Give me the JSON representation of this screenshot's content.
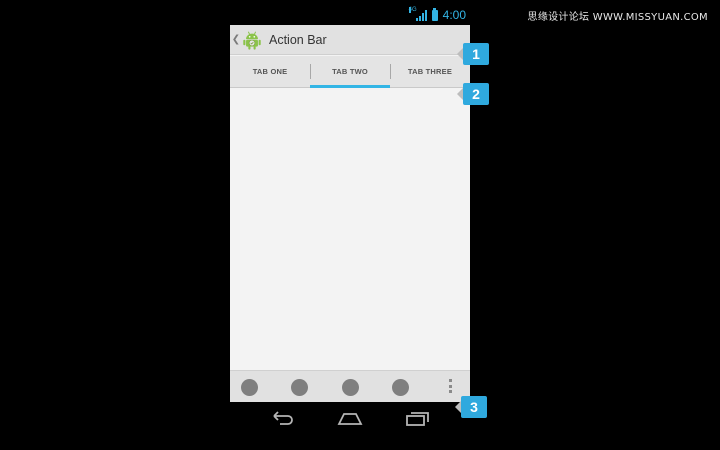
{
  "watermark": "思缘设计论坛 WWW.MISSYUAN.COM",
  "status_bar": {
    "network": "4G",
    "time": "4:00"
  },
  "action_bar": {
    "title": "Action Bar",
    "app_icon": "android-robot-icon"
  },
  "tabs": [
    {
      "label": "TAB ONE",
      "selected": false
    },
    {
      "label": "TAB TWO",
      "selected": true
    },
    {
      "label": "TAB THREE",
      "selected": false
    }
  ],
  "split_action_bar": {
    "action_count": 4,
    "overflow": "overflow-menu-icon"
  },
  "navigation": [
    "back-icon",
    "home-icon",
    "recents-icon"
  ],
  "callouts": [
    "1",
    "2",
    "3"
  ],
  "colors": {
    "accent": "#33b5e5",
    "callout": "#2fa9de",
    "background": "#000000",
    "screen": "#f3f3f3"
  }
}
